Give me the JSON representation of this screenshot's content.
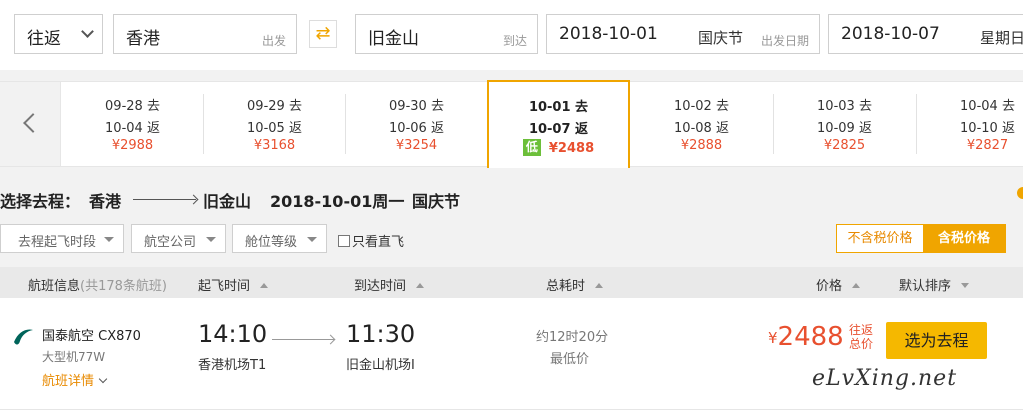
{
  "search": {
    "trip_type": "往返",
    "from_city": "香港",
    "from_hint": "出发",
    "to_city": "旧金山",
    "to_hint": "到达",
    "depart_date": "2018-10-01",
    "depart_holiday": "国庆节",
    "depart_hint": "出发日期",
    "return_date": "2018-10-07",
    "return_weekday": "星期日"
  },
  "date_strip": [
    {
      "go": "09-28 去",
      "back": "10-04 返",
      "price": "¥2988",
      "active": false
    },
    {
      "go": "09-29 去",
      "back": "10-05 返",
      "price": "¥3168",
      "active": false
    },
    {
      "go": "09-30 去",
      "back": "10-06 返",
      "price": "¥3254",
      "active": false
    },
    {
      "go": "10-01 去",
      "back": "10-07 返",
      "price": "¥2488",
      "active": true,
      "badge": "低"
    },
    {
      "go": "10-02 去",
      "back": "10-08 返",
      "price": "¥2888",
      "active": false
    },
    {
      "go": "10-03 去",
      "back": "10-09 返",
      "price": "¥2825",
      "active": false
    },
    {
      "go": "10-04 去",
      "back": "10-10 返",
      "price": "¥2827",
      "active": false
    }
  ],
  "route": {
    "prefix": "选择去程：",
    "from": "香港",
    "to": "旧金山",
    "date": "2018-10-01周一",
    "holiday": "国庆节"
  },
  "filters": {
    "depart_time": "去程起飞时段",
    "airline": "航空公司",
    "cabin": "舱位等级",
    "direct_only": "只看直飞",
    "tax_excluded": "不含税价格",
    "tax_included": "含税价格"
  },
  "table_header": {
    "info": "航班信息",
    "count": "(共178条航班)",
    "depart_time": "起飞时间",
    "arrive_time": "到达时间",
    "duration": "总耗时",
    "price": "价格",
    "sort": "默认排序"
  },
  "flight": {
    "airline": "国泰航空 CX870",
    "aircraft": "大型机77W",
    "details": "航班详情",
    "depart_time": "14:10",
    "depart_airport": "香港机场T1",
    "arrive_time": "11:30",
    "arrive_airport": "旧金山机场I",
    "duration": "约12时20分",
    "tag": "最低价",
    "currency": "¥",
    "price": "2488",
    "price_note": "往返总价",
    "select": "选为去程"
  },
  "watermark": "eLvXing.net",
  "colors": {
    "accent": "#f0a500",
    "price": "#e8502f",
    "low_badge": "#6cbf3a",
    "button": "#f5b800"
  },
  "icons": {
    "prev": "chevron-left-icon",
    "swap": "swap-arrows-icon",
    "airline": "cathay-pacific-logo-icon"
  }
}
